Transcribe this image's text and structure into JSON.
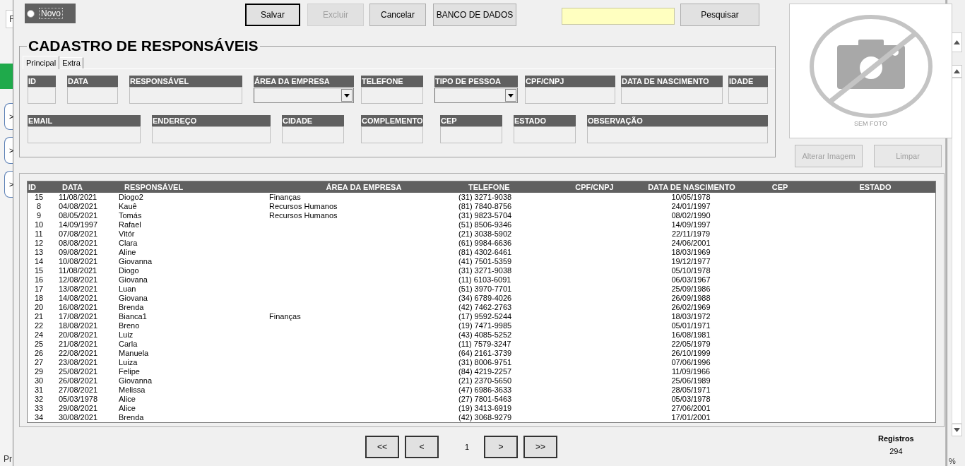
{
  "background_left": {
    "field_text": "F",
    "buttons": [
      ">",
      ">",
      ">"
    ],
    "status_text": "Pr"
  },
  "background_right": {
    "status_text": "%"
  },
  "toolbar": {
    "option": {
      "label": "Novo",
      "selected": false
    },
    "buttons": [
      {
        "label": "Salvar",
        "disabled": false,
        "default": true
      },
      {
        "label": "Excluir",
        "disabled": true,
        "default": false
      },
      {
        "label": "Cancelar",
        "disabled": false,
        "default": false
      },
      {
        "label": "BANCO DE DADOS",
        "disabled": false,
        "default": false
      }
    ],
    "search_button": "Pesquisar"
  },
  "form": {
    "title": "CADASTRO DE RESPONSÁVEIS",
    "tabs": [
      {
        "label": "Principal",
        "selected": true
      },
      {
        "label": "Extra",
        "selected": false
      }
    ],
    "fields_row1": [
      {
        "label": "ID",
        "kind": "text"
      },
      {
        "label": "DATA",
        "kind": "text"
      },
      {
        "label": "RESPONSÁVEL",
        "kind": "text"
      },
      {
        "label": "ÁREA DA EMPRESA",
        "kind": "combo"
      },
      {
        "label": "TELEFONE",
        "kind": "text"
      },
      {
        "label": "TIPO DE PESSOA",
        "kind": "combo"
      },
      {
        "label": "CPF/CNPJ",
        "kind": "text"
      },
      {
        "label": "DATA DE NASCIMENTO",
        "kind": "text"
      },
      {
        "label": "IDADE",
        "kind": "text"
      }
    ],
    "fields_row2": [
      {
        "label": "EMAIL",
        "kind": "text"
      },
      {
        "label": "ENDEREÇO",
        "kind": "text"
      },
      {
        "label": "CIDADE",
        "kind": "text"
      },
      {
        "label": "COMPLEMENTO",
        "kind": "text"
      },
      {
        "label": "CEP",
        "kind": "text"
      },
      {
        "label": "ESTADO",
        "kind": "text"
      },
      {
        "label": "OBSERVAÇÃO",
        "kind": "text"
      }
    ]
  },
  "photo": {
    "caption": "SEM FOTO",
    "buttons": [
      {
        "label": "Alterar Imagem",
        "disabled": true
      },
      {
        "label": "Limpar",
        "disabled": true
      }
    ]
  },
  "table": {
    "columns": [
      "ID",
      "DATA",
      "RESPONSÁVEL",
      "ÁREA DA EMPRESA",
      "TELEFONE",
      "CPF/CNPJ",
      "DATA DE NASCIMENTO",
      "CEP",
      "ESTADO"
    ],
    "rows": [
      {
        "id": "15",
        "data": "11/08/2021",
        "responsavel": "Diogo2",
        "area": "Finanças",
        "telefone": "(31) 3271-9038",
        "nascimento": "10/05/1978"
      },
      {
        "id": "8",
        "data": "04/08/2021",
        "responsavel": "Kauê",
        "area": "Recursos Humanos",
        "telefone": "(81) 7840-8756",
        "nascimento": "24/01/1997"
      },
      {
        "id": "9",
        "data": "08/05/2021",
        "responsavel": "Tomás",
        "area": "Recursos Humanos",
        "telefone": "(31) 9823-5704",
        "nascimento": "08/02/1990"
      },
      {
        "id": "10",
        "data": "14/09/1997",
        "responsavel": "Rafael",
        "telefone": "(51) 8506-9346",
        "nascimento": "14/09/1997"
      },
      {
        "id": "11",
        "data": "07/08/2021",
        "responsavel": "Vitór",
        "telefone": "(21) 3038-5902",
        "nascimento": "22/11/1979"
      },
      {
        "id": "12",
        "data": "08/08/2021",
        "responsavel": "Clara",
        "telefone": "(61) 9984-6636",
        "nascimento": "24/06/2001"
      },
      {
        "id": "13",
        "data": "09/08/2021",
        "responsavel": "Aline",
        "telefone": "(81) 4302-6461",
        "nascimento": "18/03/1969"
      },
      {
        "id": "14",
        "data": "10/08/2021",
        "responsavel": "Giovanna",
        "telefone": "(41) 7501-5359",
        "nascimento": "19/12/1977"
      },
      {
        "id": "15",
        "data": "11/08/2021",
        "responsavel": "Diogo",
        "telefone": "(31) 3271-9038",
        "nascimento": "05/10/1978"
      },
      {
        "id": "16",
        "data": "12/08/2021",
        "responsavel": "Giovana",
        "telefone": "(11) 6103-6091",
        "nascimento": "06/03/1967"
      },
      {
        "id": "17",
        "data": "13/08/2021",
        "responsavel": "Luan",
        "telefone": "(51) 3970-7701",
        "nascimento": "25/09/1986"
      },
      {
        "id": "18",
        "data": "14/08/2021",
        "responsavel": "Giovana",
        "telefone": "(34) 6789-4026",
        "nascimento": "26/09/1988"
      },
      {
        "id": "20",
        "data": "16/08/2021",
        "responsavel": "Brenda",
        "telefone": "(42) 7462-2763",
        "nascimento": "26/02/1969"
      },
      {
        "id": "21",
        "data": "17/08/2021",
        "responsavel": "Bianca1",
        "area": "Finanças",
        "telefone": "(17) 9592-5244",
        "nascimento": "18/03/1972"
      },
      {
        "id": "22",
        "data": "18/08/2021",
        "responsavel": "Breno",
        "telefone": "(19) 7471-9985",
        "nascimento": "05/01/1971"
      },
      {
        "id": "24",
        "data": "20/08/2021",
        "responsavel": "Luiz",
        "telefone": "(43) 4085-5252",
        "nascimento": "16/08/1981"
      },
      {
        "id": "25",
        "data": "21/08/2021",
        "responsavel": "Carla",
        "telefone": "(11) 7579-3247",
        "nascimento": "22/05/1979"
      },
      {
        "id": "26",
        "data": "22/08/2021",
        "responsavel": "Manuela",
        "telefone": "(64) 2161-3739",
        "nascimento": "26/10/1999"
      },
      {
        "id": "27",
        "data": "23/08/2021",
        "responsavel": "Luiza",
        "telefone": "(31) 8006-9751",
        "nascimento": "07/06/1996"
      },
      {
        "id": "29",
        "data": "25/08/2021",
        "responsavel": "Felipe",
        "telefone": "(84) 4219-2257",
        "nascimento": "11/09/1966"
      },
      {
        "id": "30",
        "data": "26/08/2021",
        "responsavel": "Giovanna",
        "telefone": "(21) 2370-5650",
        "nascimento": "25/06/1989"
      },
      {
        "id": "31",
        "data": "27/08/2021",
        "responsavel": "Melissa",
        "telefone": "(47) 6986-3633",
        "nascimento": "28/05/1971"
      },
      {
        "id": "32",
        "data": "05/03/1978",
        "responsavel": "Alice",
        "telefone": "(27) 7801-5463",
        "nascimento": "05/03/1978"
      },
      {
        "id": "33",
        "data": "29/08/2021",
        "responsavel": "Alice",
        "telefone": "(19) 3413-6919",
        "nascimento": "27/06/2001"
      },
      {
        "id": "34",
        "data": "30/08/2021",
        "responsavel": "Brenda",
        "telefone": "(42) 3068-9279",
        "nascimento": "17/01/2001"
      }
    ]
  },
  "pager": {
    "buttons": [
      "<<",
      "<"
    ],
    "page": "1",
    "next_buttons": [
      ">",
      ">>"
    ]
  },
  "records": {
    "label": "Registros",
    "count": "294"
  }
}
